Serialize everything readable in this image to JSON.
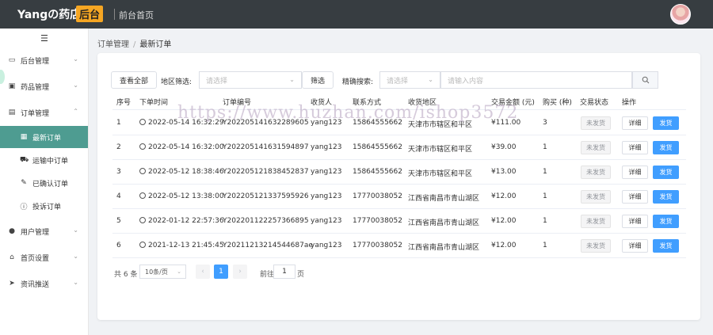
{
  "header": {
    "brand": "Yangの药店",
    "brand_badge": "后台",
    "front_link": "前台首页"
  },
  "sidebar": {
    "toggle_glyph": "☰",
    "items": [
      {
        "label": "后台管理",
        "icon": "calendar-icon",
        "expanded": false
      },
      {
        "label": "药品管理",
        "icon": "box-icon",
        "expanded": false
      },
      {
        "label": "订单管理",
        "icon": "clipboard-icon",
        "expanded": true
      },
      {
        "label": "用户管理",
        "icon": "user-icon",
        "expanded": false
      },
      {
        "label": "首页设置",
        "icon": "home-icon",
        "expanded": false
      },
      {
        "label": "资讯推送",
        "icon": "send-icon",
        "expanded": false
      }
    ],
    "sub_items": [
      {
        "label": "最新订单",
        "icon": "document-icon",
        "active": true
      },
      {
        "label": "运输中订单",
        "icon": "truck-icon",
        "active": false
      },
      {
        "label": "已确认订单",
        "icon": "edit-check-icon",
        "active": false
      },
      {
        "label": "投诉订单",
        "icon": "info-icon",
        "active": false
      }
    ]
  },
  "breadcrumb": {
    "parent": "订单管理",
    "separator": "/",
    "current": "最新订单"
  },
  "filters": {
    "view_all": "查看全部",
    "region_label": "地区筛选:",
    "region_placeholder": "请选择",
    "filter_button": "筛选",
    "search_label": "精确搜索:",
    "search_type_placeholder": "请选择",
    "search_placeholder": "请输入内容"
  },
  "table": {
    "columns": [
      "序号",
      "下单时间",
      "订单编号",
      "收货人",
      "联系方式",
      "收货地区",
      "交易金额 (元)",
      "购买 (种)",
      "交易状态",
      "操作"
    ],
    "rows": [
      {
        "idx": "1",
        "time": "2022-05-14 16:32:29",
        "order_no": "Y202205141632289605",
        "receiver": "yang123",
        "phone": "15864555662",
        "region": "天津市市辖区和平区",
        "amount": "¥111.00",
        "qty": "3",
        "status": "未发货"
      },
      {
        "idx": "2",
        "time": "2022-05-14 16:32:00",
        "order_no": "Y202205141631594897",
        "receiver": "yang123",
        "phone": "15864555662",
        "region": "天津市市辖区和平区",
        "amount": "¥39.00",
        "qty": "1",
        "status": "未发货"
      },
      {
        "idx": "3",
        "time": "2022-05-12 18:38:46",
        "order_no": "Y202205121838452837",
        "receiver": "yang123",
        "phone": "15864555662",
        "region": "天津市市辖区和平区",
        "amount": "¥13.00",
        "qty": "1",
        "status": "未发货"
      },
      {
        "idx": "4",
        "time": "2022-05-12 13:38:00",
        "order_no": "Y202205121337595926",
        "receiver": "yang123",
        "phone": "17770038052",
        "region": "江西省南昌市青山湖区",
        "amount": "¥12.00",
        "qty": "1",
        "status": "未发货"
      },
      {
        "idx": "5",
        "time": "2022-01-12 22:57:36",
        "order_no": "Y202201122257366895",
        "receiver": "yang123",
        "phone": "17770038052",
        "region": "江西省南昌市青山湖区",
        "amount": "¥12.00",
        "qty": "1",
        "status": "未发货"
      },
      {
        "idx": "6",
        "time": "2021-12-13 21:45:45",
        "order_no": "Y20211213214544687ae",
        "receiver": "yang123",
        "phone": "17770038052",
        "region": "江西省南昌市青山湖区",
        "amount": "¥12.00",
        "qty": "1",
        "status": "未发货"
      }
    ],
    "detail_label": "详细",
    "ship_label": "发货"
  },
  "pagination": {
    "total": "共 6 条",
    "page_size": "10条/页",
    "prev": "‹",
    "current_page": "1",
    "next": "›",
    "goto_label": "前往",
    "goto_value": "1",
    "goto_suffix": "页"
  },
  "watermark": "https://www.huzhan.com/ishop3572",
  "colors": {
    "topbar": "#373d41",
    "badge": "#f5a623",
    "active_menu": "#4e9c91",
    "primary": "#409eff"
  }
}
